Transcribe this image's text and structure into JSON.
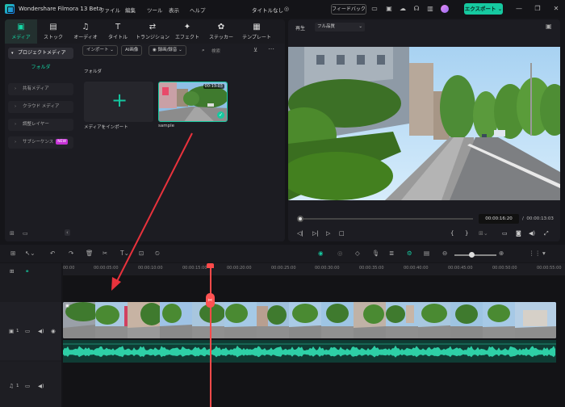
{
  "app": {
    "title": "Wondershare Filmora 13 Beta",
    "project": "タイトルなし",
    "feedback": "フィードバック",
    "export": "エクスポート"
  },
  "menu": [
    "ファイル",
    "編集",
    "ツール",
    "表示",
    "ヘルプ"
  ],
  "media_tabs": [
    {
      "label": "メディア",
      "icon": "▣"
    },
    {
      "label": "ストック",
      "icon": "▤"
    },
    {
      "label": "オーディオ",
      "icon": "♫"
    },
    {
      "label": "タイトル",
      "icon": "T"
    },
    {
      "label": "トランジション",
      "icon": "⇄"
    },
    {
      "label": "エフェクト",
      "icon": "✦"
    },
    {
      "label": "ステッカー",
      "icon": "✿"
    },
    {
      "label": "テンプレート",
      "icon": "▦"
    }
  ],
  "sidebar": {
    "project_media": "プロジェクトメディア",
    "folder": "フォルダ",
    "items": [
      "共有メディア",
      "クラウド メディア",
      "調整レイヤー",
      "サブシーケンス"
    ],
    "new_badge": "NEW"
  },
  "media_toolbar": {
    "import": "インポート",
    "ai_image": "AI画像",
    "record": "録画/録音",
    "search": "検索"
  },
  "folder_label": "フォルダ",
  "import_label": "メディアをインポート",
  "clip": {
    "name": "sample",
    "duration": "00:13:03"
  },
  "player": {
    "play_label": "再生",
    "quality": "フル品質",
    "time_current": "00:00:16:20",
    "time_separator": "/",
    "time_total": "00:00:13:03"
  },
  "ruler_ticks": [
    "00:00",
    "00:00:05:00",
    "00:00:10:00",
    "00:00:15:00",
    "00:00:20:00",
    "00:00:25:00",
    "00:00:30:00",
    "00:00:35:00",
    "00:00:40:00",
    "00:00:45:00",
    "00:00:50:00",
    "00:00:55:00"
  ],
  "tracks": {
    "video_num": "1",
    "audio_num": "1"
  },
  "colors": {
    "accent": "#16c9a0",
    "playhead": "#ff4a4a",
    "arrow": "#e8323c"
  }
}
